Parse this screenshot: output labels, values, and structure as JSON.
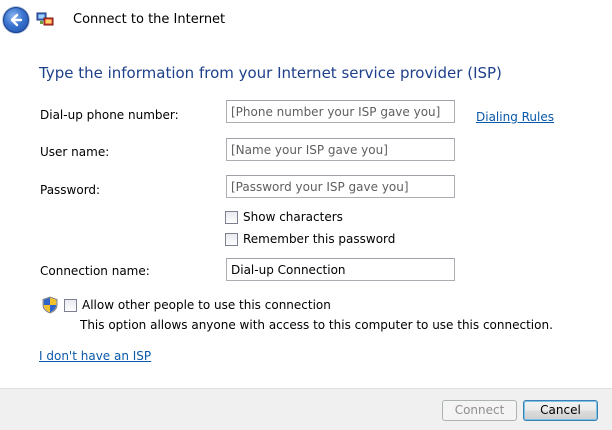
{
  "window": {
    "title": "Connect to the Internet"
  },
  "heading": "Type the information from your Internet service provider (ISP)",
  "form": {
    "phone": {
      "label": "Dial-up phone number:",
      "placeholder": "[Phone number your ISP gave you]",
      "value": ""
    },
    "dialing_rules": "Dialing Rules",
    "username": {
      "label": "User name:",
      "placeholder": "[Name your ISP gave you]",
      "value": ""
    },
    "password": {
      "label": "Password:",
      "placeholder": "[Password your ISP gave you]",
      "value": ""
    },
    "show_characters": {
      "label": "Show characters",
      "checked": false
    },
    "remember_password": {
      "label": "Remember this password",
      "checked": false
    },
    "connection_name": {
      "label": "Connection name:",
      "value": "Dial-up Connection"
    },
    "allow_others": {
      "label": "Allow other people to use this connection",
      "checked": false
    },
    "allow_others_hint": "This option allows anyone with access to this computer to use this connection."
  },
  "no_isp_link": "I don't have an ISP",
  "buttons": {
    "connect": "Connect",
    "cancel": "Cancel"
  },
  "icons": {
    "back": "back-arrow-icon",
    "network": "network-connection-icon",
    "shield": "security-shield-icon"
  },
  "colors": {
    "heading": "#1e3f8a",
    "link": "#0a58a8",
    "footer": "#f0f0f0"
  }
}
